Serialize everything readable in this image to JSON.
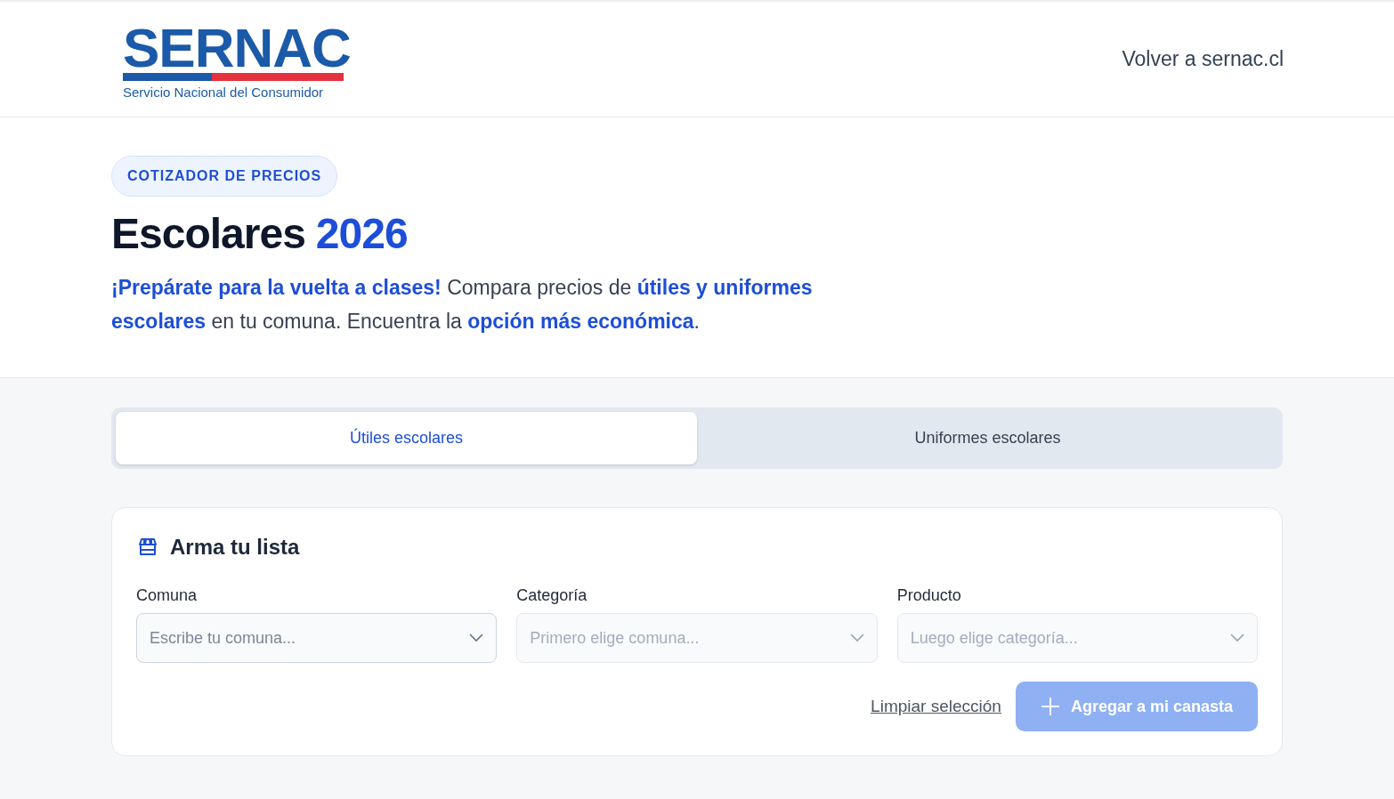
{
  "header": {
    "logo": {
      "wordmark": "SERNAC",
      "tagline": "Servicio Nacional del Consumidor"
    },
    "back_link": "Volver a sernac.cl"
  },
  "hero": {
    "badge": "COTIZADOR DE PRECIOS",
    "title": "Escolares",
    "title_accent": "2026",
    "intro": "**¡Prepárate para la vuelta a clases!** Compara precios de **útiles y uniformes escolares** en tu comuna. Encuentra la **opción más económica**."
  },
  "tabs": [
    {
      "label": "Útiles escolares",
      "selected": true
    },
    {
      "label": "Uniformes escolares",
      "selected": false
    }
  ],
  "card": {
    "title": "Arma tu lista",
    "fields": [
      {
        "label": "Comuna",
        "placeholder": "Escribe tu comuna...",
        "disabled": false
      },
      {
        "label": "Categoría",
        "placeholder": "Primero elige comuna...",
        "disabled": true
      },
      {
        "label": "Producto",
        "placeholder": "Luego elige categoría...",
        "disabled": true
      }
    ],
    "clear_link": "Limpiar selección",
    "add_button": {
      "label": "Agregar a mi canasta",
      "disabled": true
    }
  }
}
